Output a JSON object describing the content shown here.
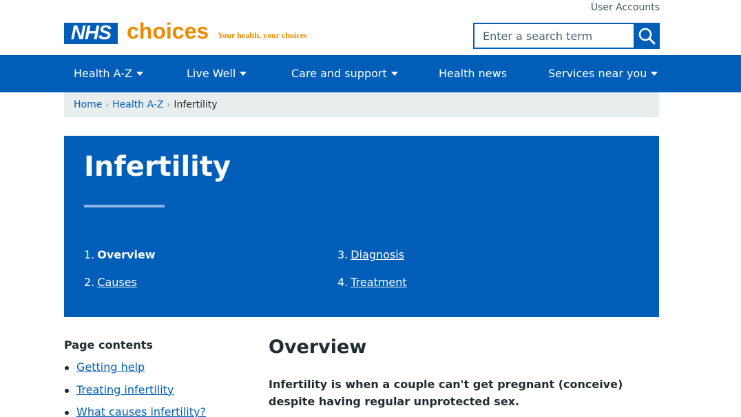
{
  "header": {
    "user_accounts": "User Accounts",
    "logo_nhs": "NHS",
    "logo_choices": "choices",
    "tagline": "Your health, your choices",
    "search_placeholder": "Enter a search term",
    "search_icon": "magnifier-icon"
  },
  "nav": {
    "items": [
      {
        "label": "Health A-Z",
        "dropdown": true
      },
      {
        "label": "Live Well",
        "dropdown": true
      },
      {
        "label": "Care and support",
        "dropdown": true
      },
      {
        "label": "Health news",
        "dropdown": false
      },
      {
        "label": "Services near you",
        "dropdown": true
      }
    ]
  },
  "breadcrumb": {
    "items": [
      "Home",
      "Health A-Z"
    ],
    "current": "Infertility"
  },
  "hero": {
    "title": "Infertility",
    "toc": [
      {
        "num": "1.",
        "label": "Overview",
        "current": true
      },
      {
        "num": "2.",
        "label": "Causes",
        "current": false
      },
      {
        "num": "3.",
        "label": "Diagnosis",
        "current": false
      },
      {
        "num": "4.",
        "label": "Treatment",
        "current": false
      }
    ]
  },
  "page_contents": {
    "title": "Page contents",
    "items": [
      "Getting help",
      "Treating infertility",
      "What causes infertility?"
    ]
  },
  "article": {
    "heading": "Overview",
    "intro": "Infertility is when a couple can't get pregnant (conceive) despite having regular unprotected sex."
  },
  "colors": {
    "nhs_blue": "#005eb8",
    "choices_orange": "#ed8b00",
    "breadcrumb_bg": "#e8edee",
    "text": "#212b32"
  }
}
